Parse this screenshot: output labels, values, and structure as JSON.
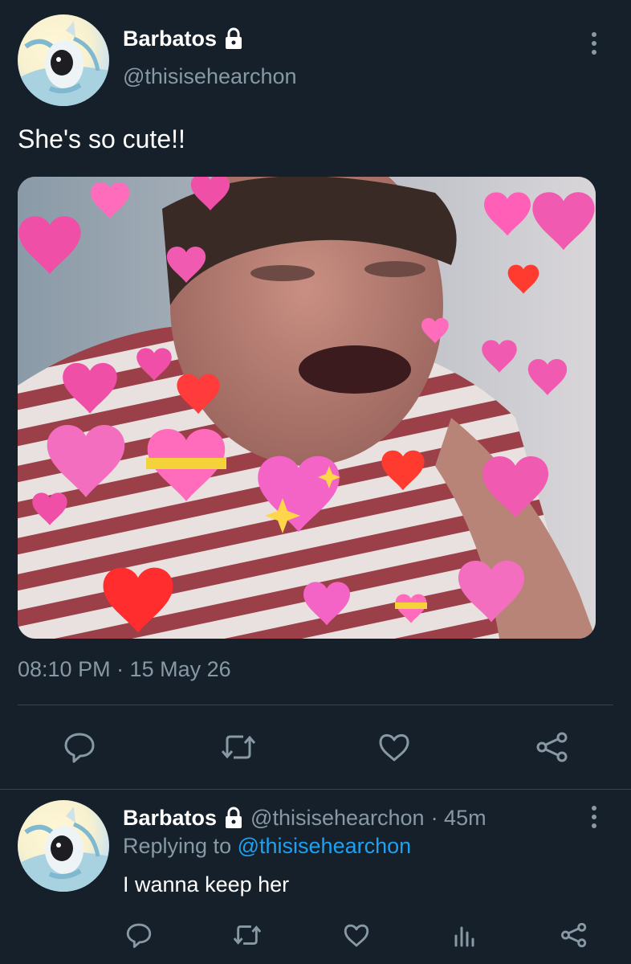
{
  "tweet": {
    "author_name": "Barbatos",
    "author_handle": "@thisisehearchon",
    "text": "She's so cute!!",
    "timestamp": "08:10 PM · 15 May 26",
    "lock_icon": "lock-icon",
    "more_icon": "kebab-icon",
    "actions": [
      "reply-icon",
      "retweet-icon",
      "like-icon",
      "share-icon"
    ]
  },
  "reply": {
    "author_name": "Barbatos",
    "author_handle": "@thisisehearchon",
    "age": "· 45m",
    "replying_to_label": "Replying to",
    "replying_to_handle": "@thisisehearchon",
    "text": "I wanna keep her",
    "actions": [
      "reply-icon",
      "retweet-icon",
      "like-icon",
      "analytics-icon",
      "share-icon"
    ]
  },
  "colors": {
    "background": "#15202b",
    "muted_text": "#8899a6",
    "link": "#1da1f2",
    "divider": "#38444d"
  }
}
